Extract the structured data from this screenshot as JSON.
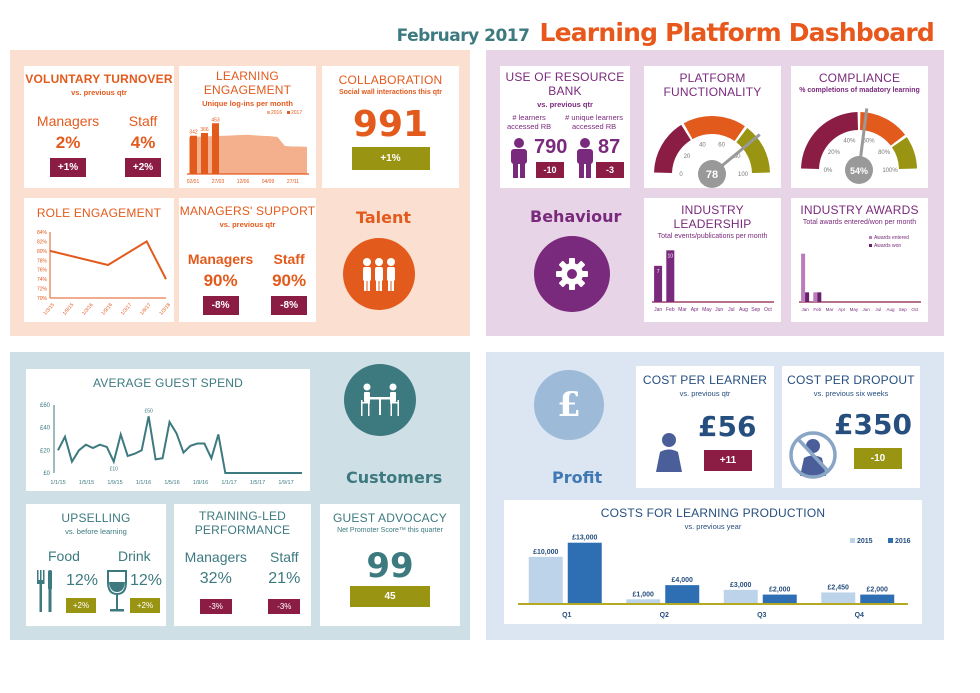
{
  "header": {
    "date": "February 2017",
    "title": "Learning Platform Dashboard"
  },
  "colors": {
    "talent": "#e35a1d",
    "behaviour": "#7a2a7c",
    "customers": "#3d7a80",
    "profit": "#264f7f",
    "negative": "#8b1d45",
    "positive": "#9a9413"
  },
  "talent": {
    "label": "Talent",
    "icon": "people-icon",
    "voluntary_turnover": {
      "title": "VOLUNTARY TURNOVER",
      "subtitle": "vs. previous qtr",
      "groups": [
        {
          "label": "Managers",
          "value": "2%",
          "change": "+1%"
        },
        {
          "label": "Staff",
          "value": "4%",
          "change": "+2%"
        }
      ]
    },
    "collaboration": {
      "title": "COLLABORATION",
      "subtitle": "Social wall interactions this qtr",
      "value": "991",
      "change": "+1%"
    },
    "managers_support": {
      "title": "MANAGERS' SUPPORT",
      "subtitle": "vs. previous qtr",
      "groups": [
        {
          "label": "Managers",
          "value": "90%",
          "change": "-8%"
        },
        {
          "label": "Staff",
          "value": "90%",
          "change": "-8%"
        }
      ]
    }
  },
  "behaviour": {
    "label": "Behaviour",
    "icon": "gear-icon",
    "resource_bank": {
      "title1": "USE OF RESOURCE",
      "title2": "BANK",
      "subtitle": "vs. previous qtr",
      "groups": [
        {
          "label1": "# learners",
          "label2": "accessed RB",
          "value": "790",
          "change": "-10"
        },
        {
          "label1": "# unique learners",
          "label2": "accessed RB",
          "value": "87",
          "change": "-3"
        }
      ]
    },
    "platform": {
      "title1": "PLATFORM",
      "title2": "FUNCTIONALITY",
      "value": "78",
      "value_fraction": 0.78,
      "ticks": [
        "0",
        "20",
        "40",
        "60",
        "80",
        "100"
      ]
    },
    "compliance": {
      "title": "COMPLIANCE",
      "subtitle": "% completions of madatory learning",
      "value": "54%",
      "value_fraction": 0.54,
      "ticks": [
        "0%",
        "20%",
        "40%",
        "60%",
        "80%",
        "100%"
      ]
    }
  },
  "customers": {
    "label": "Customers",
    "icon": "meeting-table-icon",
    "upselling": {
      "title": "UPSELLING",
      "subtitle": "vs. before learning",
      "groups": [
        {
          "label": "Food",
          "value": "12%",
          "change": "+2%"
        },
        {
          "label": "Drink",
          "value": "12%",
          "change": "+2%"
        }
      ]
    },
    "training_led": {
      "title1": "TRAINING-LED",
      "title2": "PERFORMANCE",
      "groups": [
        {
          "label": "Managers",
          "value": "32%",
          "change": "-3%"
        },
        {
          "label": "Staff",
          "value": "21%",
          "change": "-3%"
        }
      ]
    },
    "guest_advocacy": {
      "title": "GUEST ADVOCACY",
      "subtitle": "Net Promoter Score™  this quarter",
      "value": "99",
      "change": "45"
    }
  },
  "profit": {
    "label": "Profit",
    "icon": "pound-icon",
    "cost_per_learner": {
      "title": "COST PER LEARNER",
      "subtitle": "vs. previous qtr",
      "value": "£56",
      "change": "+11"
    },
    "cost_per_dropout": {
      "title": "COST PER DROPOUT",
      "subtitle": "vs. previous six weeks",
      "value": "£350",
      "change": "-10"
    }
  },
  "chart_data": [
    {
      "id": "learning_engagement",
      "type": "bar",
      "title": "LEARNING ENGAGEMENT",
      "subtitle": "Unique log-ins per month",
      "x_tick_labels": [
        "02/01",
        "27/03",
        "12/06",
        "04/09",
        "27/11"
      ],
      "series": [
        {
          "name": "2016",
          "type": "area",
          "values": [
            330,
            332,
            335,
            338,
            340,
            342,
            345,
            348,
            350,
            345,
            340,
            338,
            330,
            250,
            245,
            245,
            242
          ]
        },
        {
          "name": "2017",
          "type": "bar",
          "values": [
            342,
            366,
            453
          ],
          "labels": [
            "342",
            "366",
            "453"
          ]
        }
      ],
      "legend": [
        "2016",
        "2017"
      ],
      "legend_position": "top-right",
      "ylim": [
        0,
        500
      ]
    },
    {
      "id": "role_engagement",
      "type": "line",
      "title": "ROLE ENGAGEMENT",
      "categories": [
        "1/3/15",
        "1/9/15",
        "1/3/16",
        "1/9/16",
        "1/3/17",
        "1/9/17",
        "1/3/18"
      ],
      "x": [
        "1/3/15",
        "1/9/16",
        "1/9/17",
        "1/3/18"
      ],
      "values": [
        80,
        77,
        82,
        74
      ],
      "y_tick_labels": [
        "70%",
        "72%",
        "74%",
        "76%",
        "78%",
        "80%",
        "82%",
        "84%"
      ],
      "ylim": [
        70,
        84
      ]
    },
    {
      "id": "industry_leadership",
      "type": "bar",
      "title": "INDUSTRY LEADERSHIP",
      "subtitle": "Total events/publications per month",
      "categories": [
        "Jan",
        "Feb",
        "Mar",
        "Apr",
        "May",
        "Jun",
        "Jul",
        "Aug",
        "Sep",
        "Oct"
      ],
      "values": [
        7,
        10,
        0,
        0,
        0,
        0,
        0,
        0,
        0,
        0
      ],
      "ylim": [
        0,
        12
      ]
    },
    {
      "id": "industry_awards",
      "type": "bar",
      "title": "INDUSTRY AWARDS",
      "subtitle": "Total awards entered/won per month",
      "categories": [
        "Jan",
        "Feb",
        "Mar",
        "Apr",
        "May",
        "Jun",
        "Jul",
        "Aug",
        "Sep",
        "Oct"
      ],
      "series": [
        {
          "name": "Awards entered",
          "values": [
            5,
            1,
            0,
            0,
            0,
            0,
            0,
            0,
            0,
            0
          ]
        },
        {
          "name": "Awards won",
          "values": [
            1,
            1,
            0,
            0,
            0,
            0,
            0,
            0,
            0,
            0
          ]
        }
      ],
      "legend_position": "top-right",
      "ylim": [
        0,
        6
      ]
    },
    {
      "id": "average_guest_spend",
      "type": "line",
      "title": "AVERAGE GUEST SPEND",
      "x_tick_labels": [
        "1/1/15",
        "1/5/15",
        "1/9/15",
        "1/1/16",
        "1/5/16",
        "1/9/16",
        "1/1/17",
        "1/5/17",
        "1/9/17"
      ],
      "values": [
        20,
        32,
        10,
        20,
        25,
        22,
        25,
        23,
        10,
        34,
        15,
        17,
        20,
        50,
        12,
        13,
        45,
        35,
        18,
        24,
        26,
        26,
        13,
        34,
        0,
        0,
        0,
        0,
        0,
        0,
        0,
        0,
        0,
        0,
        0,
        0
      ],
      "annotations": [
        {
          "label": "£50",
          "index": 13
        },
        {
          "label": "£10",
          "index": 8
        }
      ],
      "y_tick_labels": [
        "£0",
        "£20",
        "£40",
        "£60"
      ],
      "ylim": [
        0,
        60
      ]
    },
    {
      "id": "costs_learning_production",
      "type": "bar",
      "title": "COSTS FOR LEARNING PRODUCTION",
      "subtitle": "vs. previous year",
      "categories": [
        "Q1",
        "Q2",
        "Q3",
        "Q4"
      ],
      "series": [
        {
          "name": "2015",
          "values": [
            10000,
            1000,
            3000,
            2450
          ],
          "labels": [
            "£10,000",
            "£1,000",
            "£3,000",
            "£2,450"
          ]
        },
        {
          "name": "2016",
          "values": [
            13000,
            4000,
            2000,
            2000
          ],
          "labels": [
            "£13,000",
            "£4,000",
            "£2,000",
            "£2,000"
          ]
        }
      ],
      "legend_position": "top-right",
      "ylim": [
        0,
        14000
      ]
    }
  ]
}
